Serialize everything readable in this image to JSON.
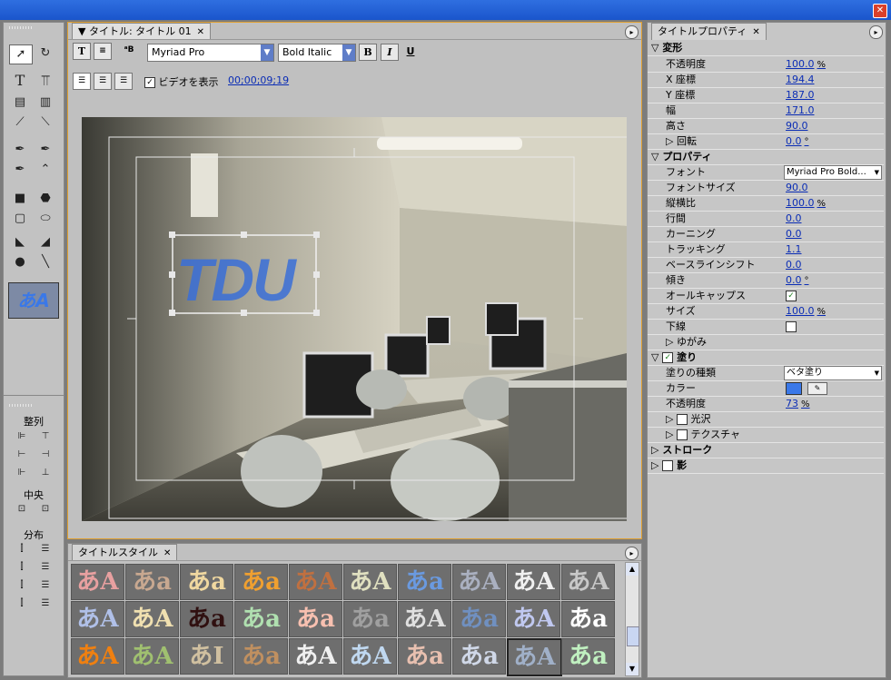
{
  "window": {
    "close_icon": "✕"
  },
  "tools_panel": {
    "align_label": "整列",
    "center_label": "中央",
    "distribute_label": "分布",
    "style_preview": "あA"
  },
  "title_panel": {
    "tab_label": "▼ タイトル: タイトル 01",
    "font_name": "Myriad Pro",
    "font_style": "Bold Italic",
    "bold_label": "B",
    "italic_label": "I",
    "underline_label": "U",
    "show_video_label": "ビデオを表示",
    "timecode": "00;00;09;19",
    "canvas_text": "TDU",
    "accent_color": "#e0a030",
    "text_color": "#3a6fd8"
  },
  "style_panel": {
    "tab_label": "タイトルスタイル",
    "swatches": [
      "あA",
      "あa",
      "あa",
      "あa",
      "あA",
      "あA",
      "あa",
      "あA",
      "あA",
      "あA",
      "あA",
      "あA",
      "あa",
      "あa",
      "あa",
      "あa",
      "あA",
      "あa",
      "あA",
      "あa",
      "あA",
      "あA",
      "あI",
      "あa",
      "あA",
      "あA",
      "あa",
      "あa",
      "あA",
      "あa"
    ]
  },
  "properties": {
    "tab_label": "タイトルプロパティ",
    "sections": {
      "transform": "変形",
      "properties": "プロパティ",
      "fill": "塗り",
      "stroke": "ストローク",
      "shadow": "影"
    },
    "rows": {
      "opacity": {
        "label": "不透明度",
        "value": "100.0",
        "unit": "%"
      },
      "x_pos": {
        "label": "X 座標",
        "value": "194.4"
      },
      "y_pos": {
        "label": "Y 座標",
        "value": "187.0"
      },
      "width": {
        "label": "幅",
        "value": "171.0"
      },
      "height": {
        "label": "高さ",
        "value": "90.0"
      },
      "rotation": {
        "label": "回転",
        "value": "0.0",
        "unit": "°"
      },
      "font": {
        "label": "フォント",
        "value": "Myriad Pro Bold..."
      },
      "font_size": {
        "label": "フォントサイズ",
        "value": "90.0"
      },
      "aspect": {
        "label": "縦横比",
        "value": "100.0",
        "unit": "%"
      },
      "leading": {
        "label": "行間",
        "value": "0.0"
      },
      "kerning": {
        "label": "カーニング",
        "value": "0.0"
      },
      "tracking": {
        "label": "トラッキング",
        "value": "1.1"
      },
      "baseline": {
        "label": "ベースラインシフト",
        "value": "0.0"
      },
      "slant": {
        "label": "傾き",
        "value": "0.0",
        "unit": "°"
      },
      "all_caps": {
        "label": "オールキャップス"
      },
      "size": {
        "label": "サイズ",
        "value": "100.0",
        "unit": "%"
      },
      "underline": {
        "label": "下線"
      },
      "distort": {
        "label": "ゆがみ"
      },
      "fill_type": {
        "label": "塗りの種類",
        "value": "ベタ塗り"
      },
      "color": {
        "label": "カラー",
        "value": "#3a78e8"
      },
      "fill_opacity": {
        "label": "不透明度",
        "value": "73",
        "unit": "%"
      },
      "sheen": {
        "label": "光沢"
      },
      "texture": {
        "label": "テクスチャ"
      }
    }
  }
}
